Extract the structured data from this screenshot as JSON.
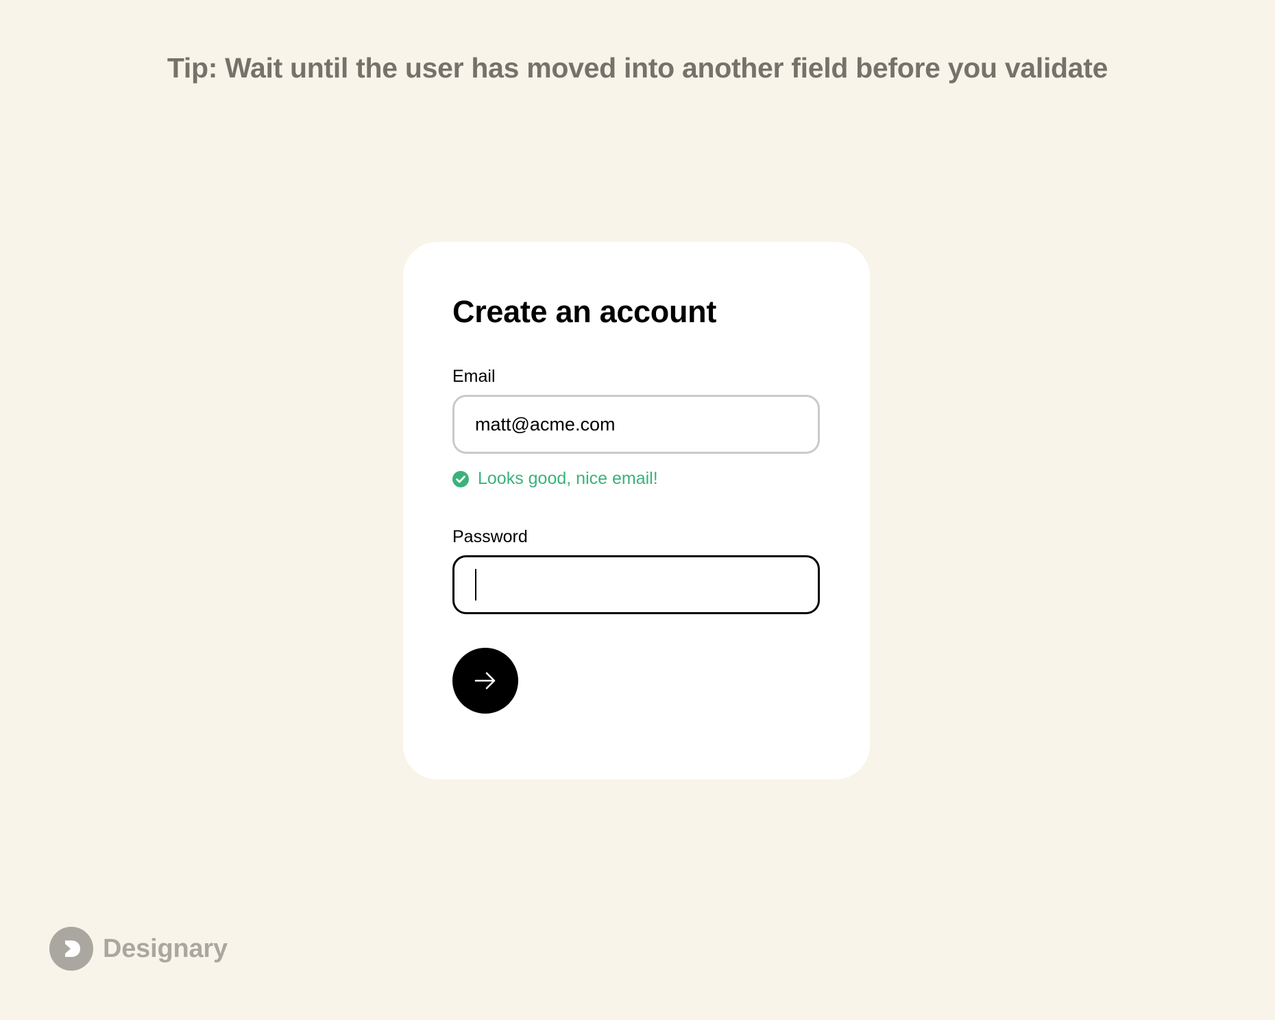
{
  "tip": {
    "text": "Tip: Wait until the user has moved into another field before you validate"
  },
  "form": {
    "title": "Create an account",
    "email": {
      "label": "Email",
      "value": "matt@acme.com",
      "validation_message": "Looks good, nice email!",
      "validation_icon": "check-circle-icon"
    },
    "password": {
      "label": "Password",
      "value": ""
    },
    "submit": {
      "icon": "arrow-right-icon"
    }
  },
  "brand": {
    "name": "Designary",
    "logo": "designary-logo-icon"
  },
  "colors": {
    "background": "#f8f4e9",
    "card": "#ffffff",
    "success": "#3bb27a",
    "tip_text": "#75726a",
    "brand_text": "#a9a7a0"
  }
}
